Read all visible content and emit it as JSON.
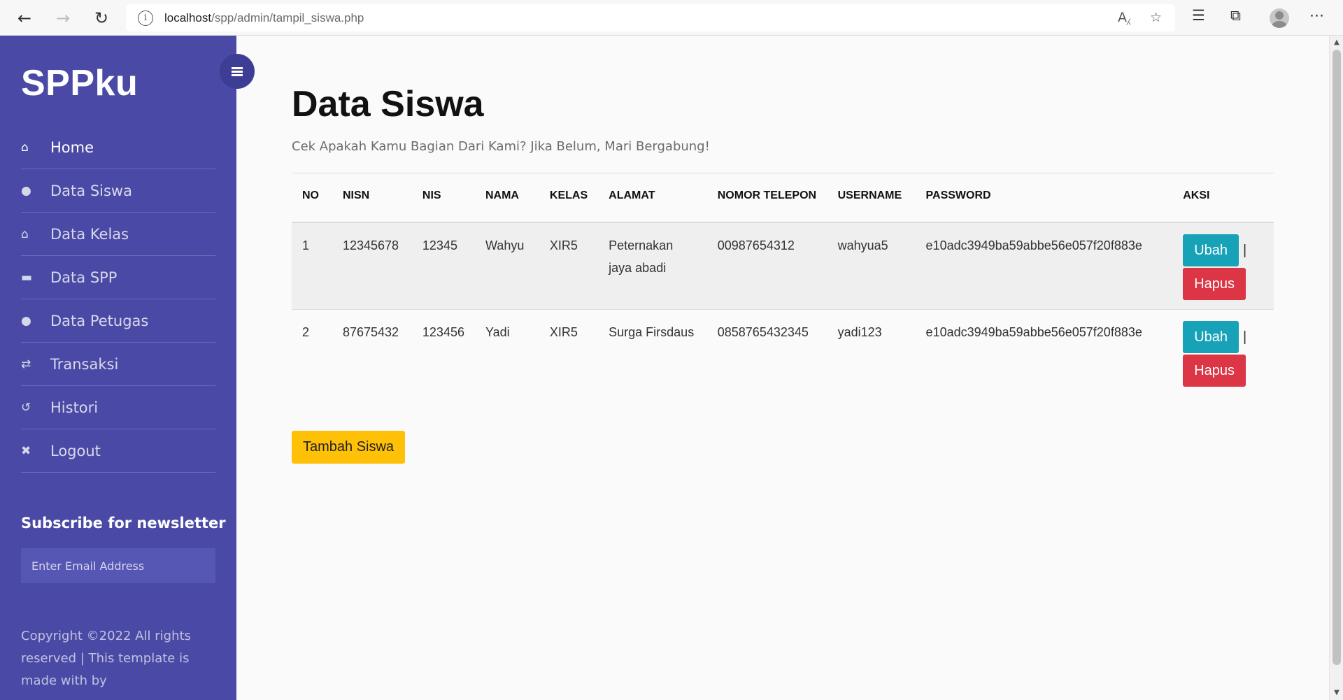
{
  "browser": {
    "url_host": "localhost",
    "url_path": "/spp/admin/tampil_siswa.php",
    "icons": [
      "back-arrow-icon",
      "forward-arrow-icon",
      "reload-icon",
      "info-icon",
      "read-aloud-icon",
      "favorite-add-icon",
      "favorites-icon",
      "collections-icon",
      "profile-icon",
      "more-icon"
    ]
  },
  "sidebar": {
    "brand": "SPPku",
    "items": [
      {
        "label": "Home",
        "icon": "home-icon",
        "glyph": "⌂",
        "active": true
      },
      {
        "label": "Data Siswa",
        "icon": "user-icon",
        "glyph": "●",
        "active": false
      },
      {
        "label": "Data Kelas",
        "icon": "home-icon",
        "glyph": "⌂",
        "active": false
      },
      {
        "label": "Data SPP",
        "icon": "briefcase-icon",
        "glyph": "▬",
        "active": false
      },
      {
        "label": "Data Petugas",
        "icon": "user-icon",
        "glyph": "●",
        "active": false
      },
      {
        "label": "Transaksi",
        "icon": "exchange-icon",
        "glyph": "⇄",
        "active": false
      },
      {
        "label": "Histori",
        "icon": "history-icon",
        "glyph": "↺",
        "active": false
      },
      {
        "label": "Logout",
        "icon": "close-icon",
        "glyph": "✖",
        "active": false
      }
    ],
    "newsletter_title": "Subscribe for newsletter",
    "email_placeholder": "Enter Email Address",
    "copyright": "Copyright ©2022 All rights reserved | This template is made with by"
  },
  "main": {
    "title": "Data Siswa",
    "subtitle": "Cek Apakah Kamu Bagian Dari Kami? Jika Belum, Mari Bergabung!",
    "table": {
      "headers": [
        "NO",
        "NISN",
        "NIS",
        "NAMA",
        "KELAS",
        "ALAMAT",
        "NOMOR TELEPON",
        "USERNAME",
        "PASSWORD",
        "AKSI"
      ],
      "rows": [
        {
          "no": "1",
          "nisn": "12345678",
          "nis": "12345",
          "nama": "Wahyu",
          "kelas": "XIR5",
          "alamat": "Peternakan jaya abadi",
          "telepon": "00987654312",
          "username": "wahyua5",
          "password": "e10adc3949ba59abbe56e057f20f883e"
        },
        {
          "no": "2",
          "nisn": "87675432",
          "nis": "123456",
          "nama": "Yadi",
          "kelas": "XIR5",
          "alamat": "Surga Firsdaus",
          "telepon": "0858765432345",
          "username": "yadi123",
          "password": "e10adc3949ba59abbe56e057f20f883e"
        }
      ],
      "edit_label": "Ubah",
      "delete_label": "Hapus",
      "separator": "|"
    },
    "add_button": "Tambah Siswa"
  },
  "colors": {
    "sidebar": "#4a4aa6",
    "edit_button": "#17a2b8",
    "delete_button": "#dc3545",
    "add_button": "#ffc107"
  }
}
